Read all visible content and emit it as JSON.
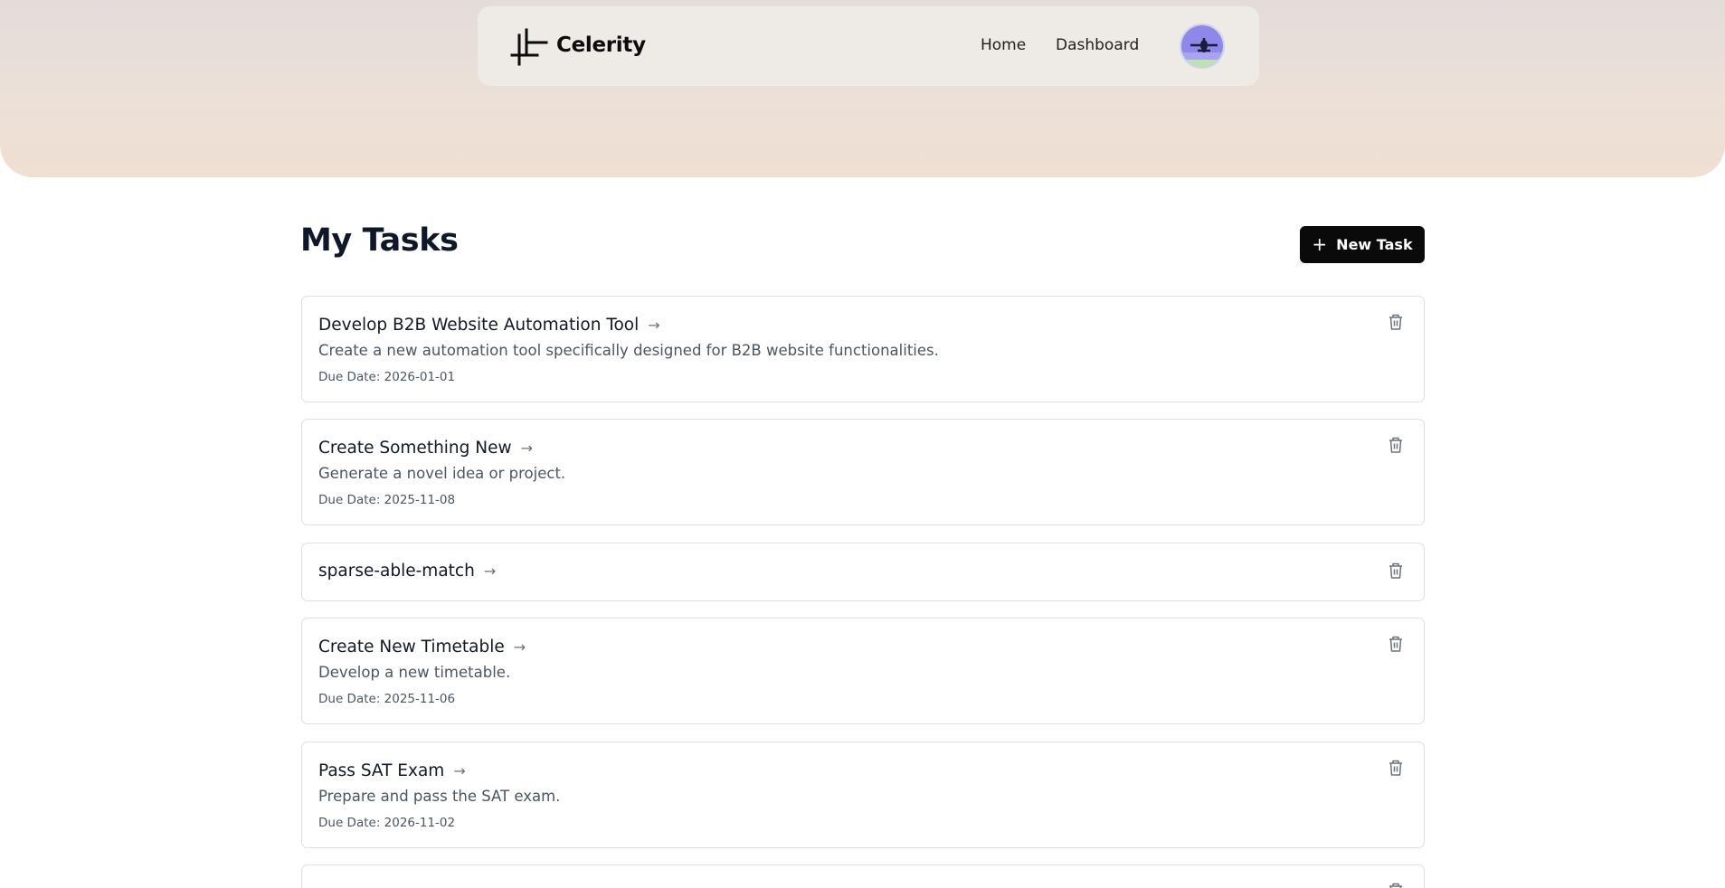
{
  "header": {
    "brand": "Celerity",
    "nav": {
      "home": "Home",
      "dashboard": "Dashboard"
    },
    "logo_icon": "plus-crosshair-logo",
    "avatar_icon": "airplane-avatar"
  },
  "main": {
    "title": "My Tasks",
    "new_task_label": "New Task"
  },
  "tasks": [
    {
      "title": "Develop B2B Website Automation Tool",
      "description": "Create a new automation tool specifically designed for B2B website functionalities.",
      "due": "Due Date: 2026-01-01"
    },
    {
      "title": "Create Something New",
      "description": "Generate a novel idea or project.",
      "due": "Due Date: 2025-11-08"
    },
    {
      "title": "sparse-able-match"
    },
    {
      "title": "Create New Timetable",
      "description": "Develop a new timetable.",
      "due": "Due Date: 2025-11-06"
    },
    {
      "title": "Pass SAT Exam",
      "description": "Prepare and pass the SAT exam.",
      "due": "Due Date: 2026-11-02"
    }
  ],
  "colors": {
    "accent": "#0a0a0a",
    "hero_top": "#e4dcda",
    "hero_bottom": "#f0dfd2",
    "card_border": "#dcdfe4"
  }
}
